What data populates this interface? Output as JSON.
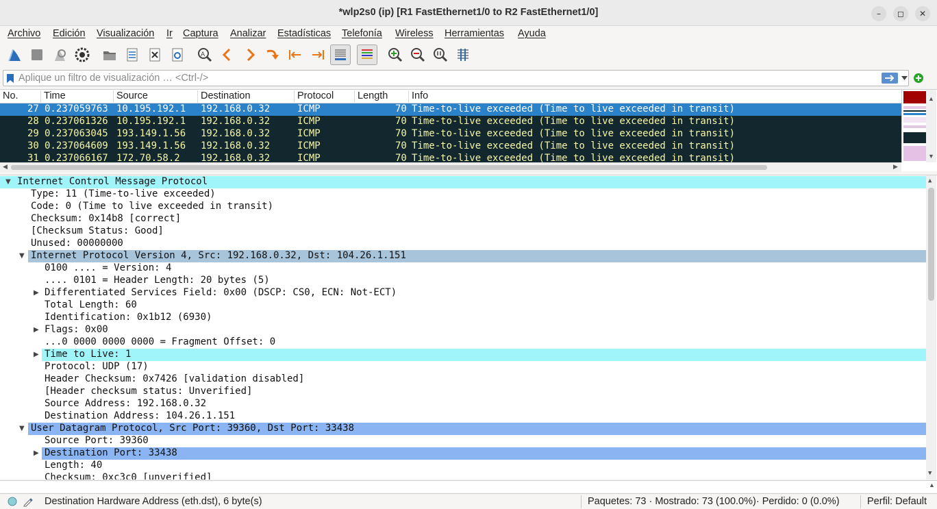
{
  "window": {
    "title": "*wlp2s0 (ip) [R1 FastEthernet1/0 to R2 FastEthernet1/0]",
    "min_glyph": "–",
    "max_glyph": "◻",
    "close_glyph": "✕"
  },
  "menu": [
    "Archivo",
    "Edición",
    "Visualización",
    "Ir",
    "Captura",
    "Analizar",
    "Estadísticas",
    "Telefonía",
    "Wireless",
    "Herramientas",
    "Ayuda"
  ],
  "filter": {
    "placeholder": "Aplique un filtro de visualización … <Ctrl-/>"
  },
  "packet_list": {
    "columns": [
      "No.",
      "Time",
      "Source",
      "Destination",
      "Protocol",
      "Length",
      "Info"
    ],
    "rows": [
      {
        "no": "27",
        "time": "0.237059763",
        "source": "10.195.192.1",
        "destination": "192.168.0.32",
        "protocol": "ICMP",
        "length": "70",
        "info": "Time-to-live exceeded (Time to live exceeded in transit)",
        "selected": true
      },
      {
        "no": "28",
        "time": "0.237061326",
        "source": "10.195.192.1",
        "destination": "192.168.0.32",
        "protocol": "ICMP",
        "length": "70",
        "info": "Time-to-live exceeded (Time to live exceeded in transit)"
      },
      {
        "no": "29",
        "time": "0.237063045",
        "source": "193.149.1.56",
        "destination": "192.168.0.32",
        "protocol": "ICMP",
        "length": "70",
        "info": "Time-to-live exceeded (Time to live exceeded in transit)"
      },
      {
        "no": "30",
        "time": "0.237064609",
        "source": "193.149.1.56",
        "destination": "192.168.0.32",
        "protocol": "ICMP",
        "length": "70",
        "info": "Time-to-live exceeded (Time to live exceeded in transit)"
      },
      {
        "no": "31",
        "time": "0.237066167",
        "source": "172.70.58.2",
        "destination": "192.168.0.32",
        "protocol": "ICMP",
        "length": "70",
        "info": "Time-to-live exceeded (Time to live exceeded in transit)"
      }
    ]
  },
  "details": [
    {
      "text": "Internet Control Message Protocol",
      "level": 0,
      "arrow": "down",
      "hl": "cyan"
    },
    {
      "text": "Type: 11 (Time-to-live exceeded)",
      "level": 1
    },
    {
      "text": "Code: 0 (Time to live exceeded in transit)",
      "level": 1
    },
    {
      "text": "Checksum: 0x14b8 [correct]",
      "level": 1
    },
    {
      "text": "[Checksum Status: Good]",
      "level": 1
    },
    {
      "text": "Unused: 00000000",
      "level": 1
    },
    {
      "text": "Internet Protocol Version 4, Src: 192.168.0.32, Dst: 104.26.1.151",
      "level": 1,
      "arrow": "down",
      "hl": "steel"
    },
    {
      "text": "0100 .... = Version: 4",
      "level": 2
    },
    {
      "text": ".... 0101 = Header Length: 20 bytes (5)",
      "level": 2
    },
    {
      "text": "Differentiated Services Field: 0x00 (DSCP: CS0, ECN: Not-ECT)",
      "level": 2,
      "arrow": "right"
    },
    {
      "text": "Total Length: 60",
      "level": 2
    },
    {
      "text": "Identification: 0x1b12 (6930)",
      "level": 2
    },
    {
      "text": "Flags: 0x00",
      "level": 2,
      "arrow": "right"
    },
    {
      "text": "...0 0000 0000 0000 = Fragment Offset: 0",
      "level": 2
    },
    {
      "text": "Time to Live: 1",
      "level": 2,
      "arrow": "right",
      "hl": "cyan"
    },
    {
      "text": "Protocol: UDP (17)",
      "level": 2
    },
    {
      "text": "Header Checksum: 0x7426 [validation disabled]",
      "level": 2
    },
    {
      "text": "[Header checksum status: Unverified]",
      "level": 2
    },
    {
      "text": "Source Address: 192.168.0.32",
      "level": 2
    },
    {
      "text": "Destination Address: 104.26.1.151",
      "level": 2
    },
    {
      "text": "User Datagram Protocol, Src Port: 39360, Dst Port: 33438",
      "level": 1,
      "arrow": "down",
      "hl": "blue"
    },
    {
      "text": "Source Port: 39360",
      "level": 2
    },
    {
      "text": "Destination Port: 33438",
      "level": 2,
      "arrow": "right",
      "hl": "blue"
    },
    {
      "text": "Length: 40",
      "level": 2
    },
    {
      "text": "Checksum: 0xc3c0 [unverified]",
      "level": 2
    }
  ],
  "status": {
    "field_info": "Destination Hardware Address (eth.dst), 6 byte(s)",
    "counts": "Paquetes: 73 · Mostrado: 73 (100.0%)· Perdido: 0 (0.0%)",
    "profile": "Perfil: Default"
  },
  "colors": {
    "selected_row": "#2c82c9",
    "dark_row": "#12272e",
    "dark_row_text": "#f7f7a5",
    "accent_blue": "#2a6ebb"
  }
}
